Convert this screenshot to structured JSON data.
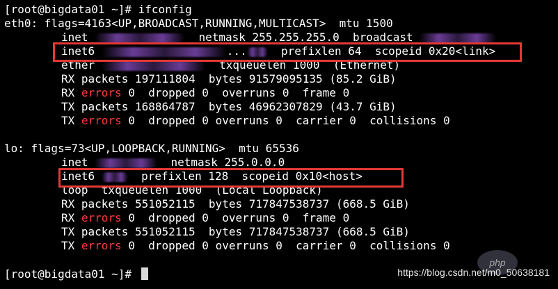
{
  "prompt1": "[root@bigdata01 ~]# ifconfig",
  "eth0": {
    "header": "eth0: flags=4163<UP,BROADCAST,RUNNING,MULTICAST>  mtu 1500",
    "inet_a": "inet ",
    "inet_b": "  netmask 255.255.255.0  broadcast ",
    "inet6_a": "inet6 ",
    "inet6_b": "...",
    "inet6_c": "  prefixlen 64  scopeid 0x20<link>",
    "ether_a": "ether ",
    "ether_b": "  txqueuelen 1000  (Ethernet)",
    "rx_packets": "RX packets 197111804  bytes 91579095135 (85.2 GiB)",
    "rx_err_label": "RX ",
    "rx_err_word": "errors",
    "rx_err_rest": " 0  dropped 0  overruns 0  frame 0",
    "tx_packets": "TX packets 168864787  bytes 46962307829 (43.7 GiB)",
    "tx_err_label": "TX ",
    "tx_err_word": "errors",
    "tx_err_rest": " 0  dropped 0 overruns 0  carrier 0  collisions 0"
  },
  "lo": {
    "header": "lo: flags=73<UP,LOOPBACK,RUNNING>  mtu 65536",
    "inet_a": "inet ",
    "inet_b": "  netmask 255.0.0.0",
    "inet6_a": "inet6 ",
    "inet6_b": "  prefixlen 128  scopeid 0x10<host>",
    "loop": "loop  txqueuelen 1000  (Local Loopback)",
    "rx_packets": "RX packets 551052115  bytes 717847538737 (668.5 GiB)",
    "rx_err_label": "RX ",
    "rx_err_word": "errors",
    "rx_err_rest": " 0  dropped 0  overruns 0  frame 0",
    "tx_packets": "TX packets 551052115  bytes 717847538737 (668.5 GiB)",
    "tx_err_label": "TX ",
    "tx_err_word": "errors",
    "tx_err_rest": " 0  dropped 0 overruns 0  carrier 0  collisions 0"
  },
  "prompt2": "[root@bigdata01 ~]# ",
  "watermark": "https://blog.csdn.net/m0_50638181",
  "logo_text": "php",
  "colors": {
    "error": "#ff3b3b",
    "highlight_box": "#e53935",
    "background": "#000000",
    "text": "#ffffff"
  }
}
